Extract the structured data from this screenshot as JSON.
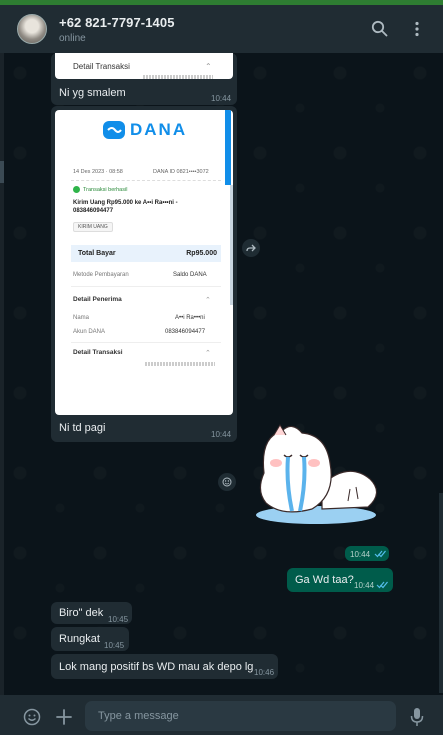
{
  "header": {
    "contact_name": "+62 821-7797-1405",
    "status": "online",
    "icons": [
      "search-icon",
      "menu-dots-icon"
    ]
  },
  "messages": [
    {
      "type": "image",
      "caption": "Ni yg smalem",
      "time": "10:44",
      "direction": "in",
      "receipt": {
        "section": "Detail Transaksi"
      }
    },
    {
      "type": "image",
      "caption": "Ni td pagi",
      "time": "10:44",
      "direction": "in",
      "receipt": {
        "brand": "DANA",
        "date": "14 Des 2023 · 08:58",
        "dana_id": "DANA ID 0821••••3072",
        "status": "Transaksi berhasil",
        "title": "Kirim Uang Rp95.000 ke A••i Ra•••ni - 083846094477",
        "tag": "KIRIM UANG",
        "total_label": "Total Bayar",
        "total_value": "Rp95.000",
        "method_label": "Metode Pembayaran",
        "method_value": "Saldo DANA",
        "recipient_section": "Detail Penerima",
        "name_label": "Nama",
        "name_value": "A••i Ra•••ni",
        "account_label": "Akun DANA",
        "account_value": "083846094477",
        "transaction_section": "Detail Transaksi"
      }
    },
    {
      "type": "sticker",
      "direction": "out",
      "time": "10:44"
    },
    {
      "type": "text",
      "text": "Ga Wd taa?",
      "time": "10:44",
      "direction": "out"
    },
    {
      "type": "text",
      "text": "Biro\" dek",
      "time": "10:45",
      "direction": "in"
    },
    {
      "type": "text",
      "text": "Rungkat",
      "time": "10:45",
      "direction": "in"
    },
    {
      "type": "text",
      "text": "Lok mang positif bs WD mau ak depo lg",
      "time": "10:46",
      "direction": "in"
    }
  ],
  "composer": {
    "placeholder": "Type a message",
    "icons": [
      "emoji-icon",
      "attach-plus-icon",
      "microphone-icon"
    ]
  },
  "colors": {
    "chat_bg": "#0b141a",
    "incoming_bubble": "#202c33",
    "outgoing_bubble": "#005c4b",
    "dana_blue": "#118ee9",
    "read_ticks": "#53bdeb"
  }
}
